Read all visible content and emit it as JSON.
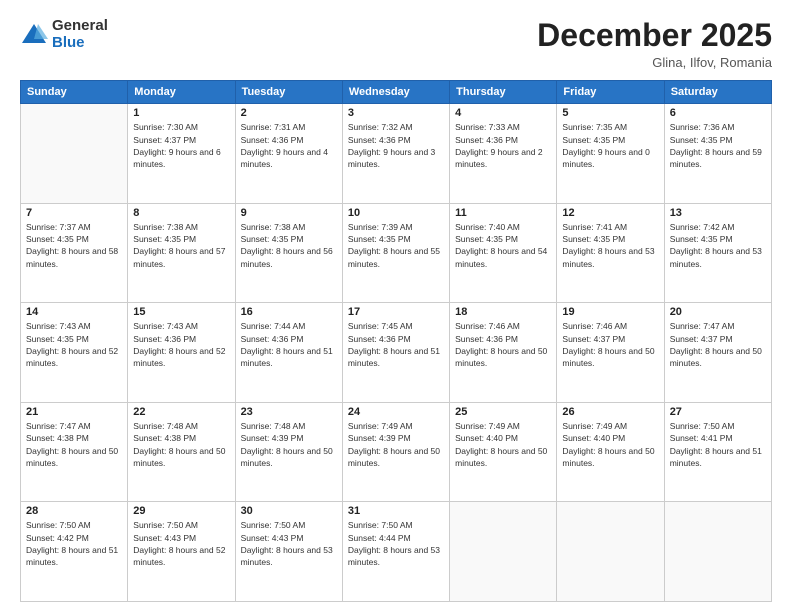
{
  "logo": {
    "general": "General",
    "blue": "Blue"
  },
  "title": "December 2025",
  "location": "Glina, Ilfov, Romania",
  "days_of_week": [
    "Sunday",
    "Monday",
    "Tuesday",
    "Wednesday",
    "Thursday",
    "Friday",
    "Saturday"
  ],
  "weeks": [
    [
      {
        "day": "",
        "sunrise": "",
        "sunset": "",
        "daylight": "",
        "empty": true
      },
      {
        "day": "1",
        "sunrise": "7:30 AM",
        "sunset": "4:37 PM",
        "daylight": "9 hours and 6 minutes."
      },
      {
        "day": "2",
        "sunrise": "7:31 AM",
        "sunset": "4:36 PM",
        "daylight": "9 hours and 4 minutes."
      },
      {
        "day": "3",
        "sunrise": "7:32 AM",
        "sunset": "4:36 PM",
        "daylight": "9 hours and 3 minutes."
      },
      {
        "day": "4",
        "sunrise": "7:33 AM",
        "sunset": "4:36 PM",
        "daylight": "9 hours and 2 minutes."
      },
      {
        "day": "5",
        "sunrise": "7:35 AM",
        "sunset": "4:35 PM",
        "daylight": "9 hours and 0 minutes."
      },
      {
        "day": "6",
        "sunrise": "7:36 AM",
        "sunset": "4:35 PM",
        "daylight": "8 hours and 59 minutes."
      }
    ],
    [
      {
        "day": "7",
        "sunrise": "7:37 AM",
        "sunset": "4:35 PM",
        "daylight": "8 hours and 58 minutes."
      },
      {
        "day": "8",
        "sunrise": "7:38 AM",
        "sunset": "4:35 PM",
        "daylight": "8 hours and 57 minutes."
      },
      {
        "day": "9",
        "sunrise": "7:38 AM",
        "sunset": "4:35 PM",
        "daylight": "8 hours and 56 minutes."
      },
      {
        "day": "10",
        "sunrise": "7:39 AM",
        "sunset": "4:35 PM",
        "daylight": "8 hours and 55 minutes."
      },
      {
        "day": "11",
        "sunrise": "7:40 AM",
        "sunset": "4:35 PM",
        "daylight": "8 hours and 54 minutes."
      },
      {
        "day": "12",
        "sunrise": "7:41 AM",
        "sunset": "4:35 PM",
        "daylight": "8 hours and 53 minutes."
      },
      {
        "day": "13",
        "sunrise": "7:42 AM",
        "sunset": "4:35 PM",
        "daylight": "8 hours and 53 minutes."
      }
    ],
    [
      {
        "day": "14",
        "sunrise": "7:43 AM",
        "sunset": "4:35 PM",
        "daylight": "8 hours and 52 minutes."
      },
      {
        "day": "15",
        "sunrise": "7:43 AM",
        "sunset": "4:36 PM",
        "daylight": "8 hours and 52 minutes."
      },
      {
        "day": "16",
        "sunrise": "7:44 AM",
        "sunset": "4:36 PM",
        "daylight": "8 hours and 51 minutes."
      },
      {
        "day": "17",
        "sunrise": "7:45 AM",
        "sunset": "4:36 PM",
        "daylight": "8 hours and 51 minutes."
      },
      {
        "day": "18",
        "sunrise": "7:46 AM",
        "sunset": "4:36 PM",
        "daylight": "8 hours and 50 minutes."
      },
      {
        "day": "19",
        "sunrise": "7:46 AM",
        "sunset": "4:37 PM",
        "daylight": "8 hours and 50 minutes."
      },
      {
        "day": "20",
        "sunrise": "7:47 AM",
        "sunset": "4:37 PM",
        "daylight": "8 hours and 50 minutes."
      }
    ],
    [
      {
        "day": "21",
        "sunrise": "7:47 AM",
        "sunset": "4:38 PM",
        "daylight": "8 hours and 50 minutes."
      },
      {
        "day": "22",
        "sunrise": "7:48 AM",
        "sunset": "4:38 PM",
        "daylight": "8 hours and 50 minutes."
      },
      {
        "day": "23",
        "sunrise": "7:48 AM",
        "sunset": "4:39 PM",
        "daylight": "8 hours and 50 minutes."
      },
      {
        "day": "24",
        "sunrise": "7:49 AM",
        "sunset": "4:39 PM",
        "daylight": "8 hours and 50 minutes."
      },
      {
        "day": "25",
        "sunrise": "7:49 AM",
        "sunset": "4:40 PM",
        "daylight": "8 hours and 50 minutes."
      },
      {
        "day": "26",
        "sunrise": "7:49 AM",
        "sunset": "4:40 PM",
        "daylight": "8 hours and 50 minutes."
      },
      {
        "day": "27",
        "sunrise": "7:50 AM",
        "sunset": "4:41 PM",
        "daylight": "8 hours and 51 minutes."
      }
    ],
    [
      {
        "day": "28",
        "sunrise": "7:50 AM",
        "sunset": "4:42 PM",
        "daylight": "8 hours and 51 minutes."
      },
      {
        "day": "29",
        "sunrise": "7:50 AM",
        "sunset": "4:43 PM",
        "daylight": "8 hours and 52 minutes."
      },
      {
        "day": "30",
        "sunrise": "7:50 AM",
        "sunset": "4:43 PM",
        "daylight": "8 hours and 53 minutes."
      },
      {
        "day": "31",
        "sunrise": "7:50 AM",
        "sunset": "4:44 PM",
        "daylight": "8 hours and 53 minutes."
      },
      {
        "day": "",
        "sunrise": "",
        "sunset": "",
        "daylight": "",
        "empty": true
      },
      {
        "day": "",
        "sunrise": "",
        "sunset": "",
        "daylight": "",
        "empty": true
      },
      {
        "day": "",
        "sunrise": "",
        "sunset": "",
        "daylight": "",
        "empty": true
      }
    ]
  ],
  "labels": {
    "sunrise_prefix": "Sunrise: ",
    "sunset_prefix": "Sunset: ",
    "daylight_prefix": "Daylight: "
  }
}
